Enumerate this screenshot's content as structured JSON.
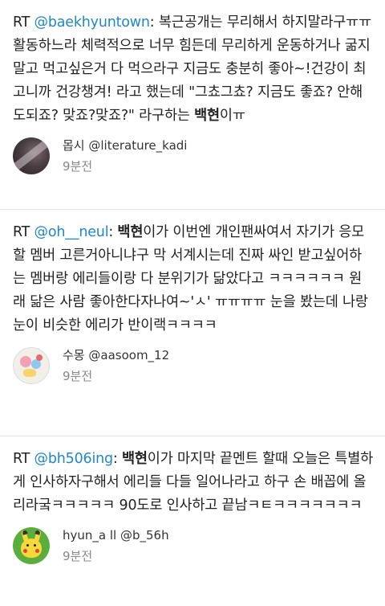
{
  "colors": {
    "mention": "#1e88c8",
    "text": "#222222",
    "timestamp": "#888888",
    "divider": "#e3e3e3"
  },
  "tweets": [
    {
      "rt_prefix": "RT ",
      "mention": "@baekhyuntown",
      "text": ": 복근공개는 무리해서 하지말라구ㅠㅠ 활동하느라 체력적으로 너무 힘든데 무리하게 운동하거나 굶지말고 먹고싶은거 다 먹으라구 지금도 충분히 좋아~!건강이 최고니까 건강챙겨! 라고 했는데 \"그쵸그쵸? 지금도 좋죠? 안해도되죠? 맞죠?맞죠?\" 라구하는 ",
      "bold": "백현",
      "text_end": "이ㅠ",
      "author_name": "몹시",
      "author_handle": "@literature_kadi",
      "avatar_icon": "dark-photo-avatar",
      "timestamp": "9분전"
    },
    {
      "rt_prefix": "RT ",
      "mention": "@oh__neul",
      "text": ": ",
      "bold": "백현",
      "text_end": "이가 이번엔 개인팬싸여서 자기가 응모할 멤버 고른거아니냐구 막 서계시는데 진짜 싸인 받고싶어하는 멤버랑 에리들이랑 다 분위기가 닮았다고 ㅋㅋㅋㅋㅋㅋ 원래 닮은 사람 좋아한다자나여~'ㅅ' ㅠㅠㅠㅠ 눈을 봤는데 나랑 눈이 비슷한 에리가 반이랙ㅋㅋㅋㅋ",
      "author_name": "수몽",
      "author_handle": "@aasoom_12",
      "avatar_icon": "colorful-illustration-avatar",
      "timestamp": "9분전"
    },
    {
      "rt_prefix": "RT ",
      "mention": "@bh506ing",
      "text": ": ",
      "bold": "백현",
      "text_end": "이가 마지막 끝멘트 할때 오늘은 특별하게 인사하자구해서 에리들 다들 일어나라고 하구 손 배꼽에 올리라궄ㅋㅋㅋㅋㅋ 90도로 인사하고 끝남ㅋㅌㅋㅋㅋㅋㅋㅋㅋ",
      "author_name": "hyun_a ll",
      "author_handle": "@b_56h",
      "avatar_icon": "pikachu-avatar",
      "timestamp": "9분전"
    }
  ]
}
